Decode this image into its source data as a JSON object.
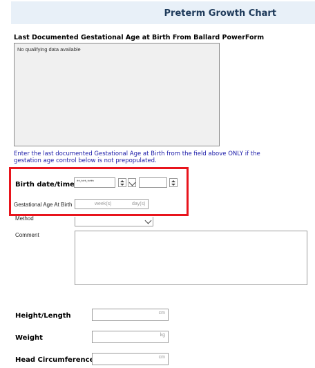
{
  "header": {
    "title": "Preterm Growth Chart"
  },
  "ballard": {
    "section_title": "Last Documented Gestational Age at Birth From Ballard PowerForm",
    "empty_text": "No qualifying data available"
  },
  "instruction": "Enter the last documented Gestational Age at Birth from the field above ONLY if the gestation age control below is not prepopulated.",
  "birth": {
    "label": "Birth date/time",
    "date_placeholder": "**-***-****",
    "time_value": ""
  },
  "gestational_age": {
    "label": "Gestational Age At Birth",
    "week_unit": "week(s)",
    "day_unit": "day(s)"
  },
  "method": {
    "label": "Method",
    "value": ""
  },
  "comment": {
    "label": "Comment",
    "value": ""
  },
  "measurements": [
    {
      "label": "Height/Length",
      "unit": "cm"
    },
    {
      "label": "Weight",
      "unit": "kg"
    },
    {
      "label": "Head Circumference",
      "unit": "cm"
    }
  ],
  "colors": {
    "highlight": "#e8141c",
    "instruction_text": "#1a1aa8",
    "banner_bg": "#e8f0f8"
  },
  "icons": {
    "spinner": "up-down-spinner-icon",
    "dropdown": "chevron-down-icon"
  }
}
